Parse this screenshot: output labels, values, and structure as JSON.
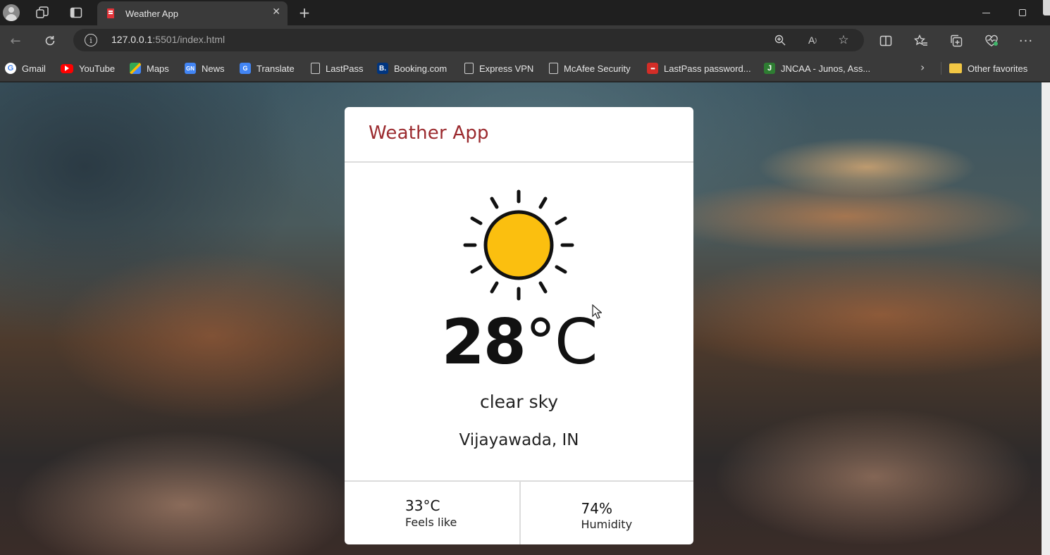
{
  "browser": {
    "tab_title": "Weather App",
    "url_host": "127.0.0.1",
    "url_rest": ":5501/index.html",
    "bookmarks": [
      {
        "label": "Gmail",
        "icon": "google-icon"
      },
      {
        "label": "YouTube",
        "icon": "youtube-icon"
      },
      {
        "label": "Maps",
        "icon": "maps-icon"
      },
      {
        "label": "News",
        "icon": "news-icon"
      },
      {
        "label": "Translate",
        "icon": "translate-icon"
      },
      {
        "label": "LastPass",
        "icon": "page-icon"
      },
      {
        "label": "Booking.com",
        "icon": "booking-icon"
      },
      {
        "label": "Express VPN",
        "icon": "page-icon"
      },
      {
        "label": "McAfee Security",
        "icon": "page-icon"
      },
      {
        "label": "LastPass password...",
        "icon": "lastpass-icon"
      },
      {
        "label": "JNCAA - Junos, Ass...",
        "icon": "j-icon"
      }
    ],
    "other_favorites": "Other favorites"
  },
  "app": {
    "title": "Weather App",
    "icon": "sun-icon",
    "temperature": "28",
    "unit": "°C",
    "description": "clear sky",
    "location": "Vijayawada, IN",
    "feels_like_value": "33°C",
    "feels_like_label": "Feels like",
    "humidity_value": "74%",
    "humidity_label": "Humidity"
  },
  "colors": {
    "title_color": "#9b2a2e",
    "sun_fill": "#fbbf0f",
    "tab_active": "#3a3a3a",
    "tabbar": "#1f1f1f"
  }
}
